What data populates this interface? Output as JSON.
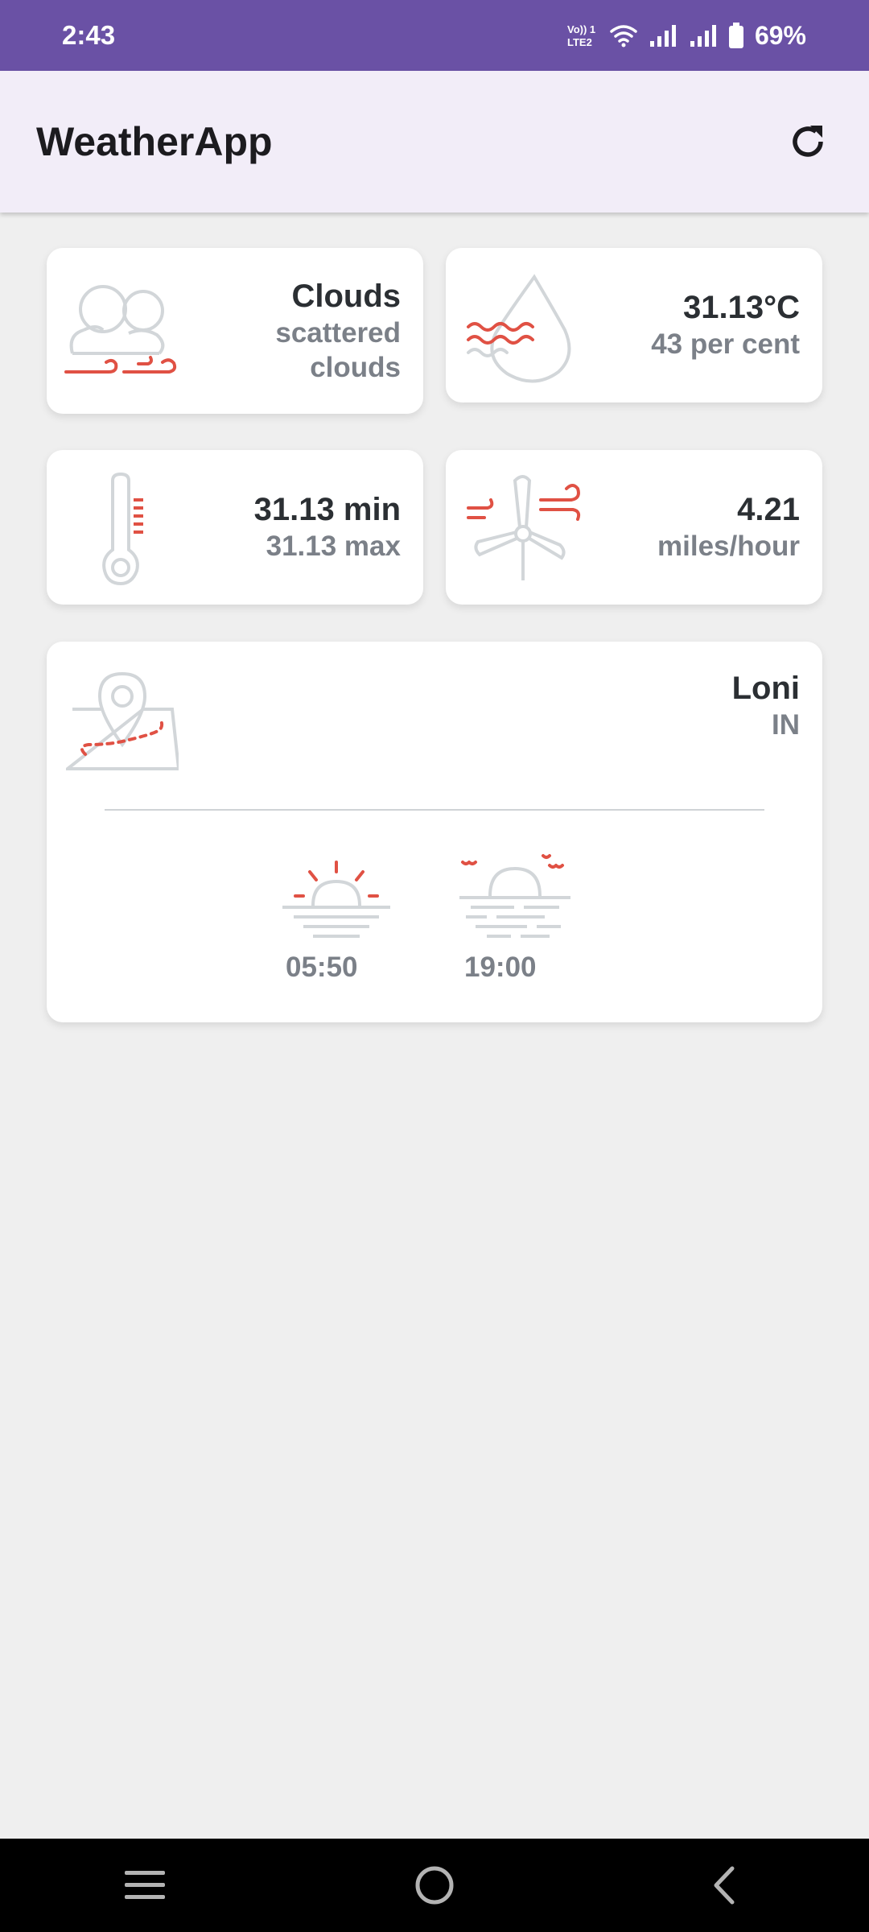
{
  "status_bar": {
    "time": "2:43",
    "volte_label_top": "Vo)) 1",
    "volte_label_bottom": "LTE2",
    "battery_percent": "69%"
  },
  "app_bar": {
    "title": "WeatherApp",
    "refresh_icon": "refresh-icon"
  },
  "weather": {
    "condition_main": "Clouds",
    "condition_desc": "scattered clouds",
    "temperature": "31.13°C",
    "humidity": "43 per cent",
    "temp_min": "31.13 min",
    "temp_max": "31.13 max",
    "wind_speed": "4.21",
    "wind_unit": "miles/hour"
  },
  "location": {
    "city": "Loni",
    "country": "IN",
    "sunrise": "05:50",
    "sunset": "19:00"
  },
  "colors": {
    "accent_red": "#e05144",
    "icon_gray": "#d2d6d9",
    "status_purple": "#6a51a5"
  }
}
